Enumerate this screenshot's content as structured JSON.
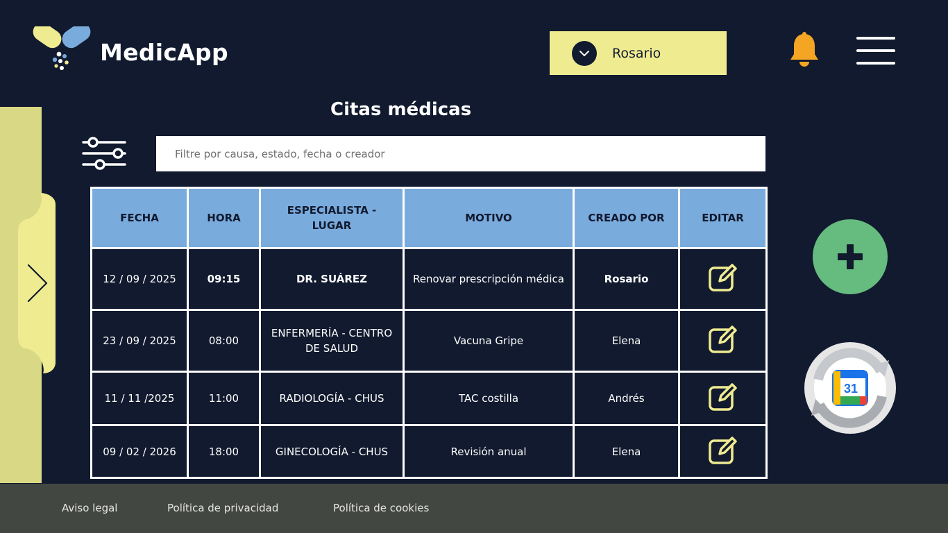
{
  "header": {
    "brand": "MedicApp",
    "user_selector": {
      "selected": "Rosario"
    }
  },
  "page": {
    "title": "Citas médicas"
  },
  "search": {
    "placeholder": "Filtre por causa, estado, fecha o creador"
  },
  "table": {
    "columns": [
      "FECHA",
      "HORA",
      "ESPECIALISTA - LUGAR",
      "MOTIVO",
      "CREADO POR",
      "EDITAR"
    ],
    "rows": [
      {
        "fecha": "12 / 09 / 2025",
        "hora": "09:15",
        "especialista": "DR. SUÁREZ",
        "motivo": "Renovar prescripción médica",
        "creado_por": "Rosario"
      },
      {
        "fecha": "23 / 09 / 2025",
        "hora": "08:00",
        "especialista": "ENFERMERÍA - CENTRO DE SALUD",
        "motivo": "Vacuna Gripe",
        "creado_por": "Elena"
      },
      {
        "fecha": "11 / 11 /2025",
        "hora": "11:00",
        "especialista": "RADIOLOGÍA - CHUS",
        "motivo": "TAC costilla",
        "creado_por": "Andrés"
      },
      {
        "fecha": "09 / 02 / 2026",
        "hora": "18:00",
        "especialista": "GINECOLOGÍA - CHUS",
        "motivo": "Revisión anual",
        "creado_por": "Elena"
      }
    ]
  },
  "calendar_icon": {
    "day": "31"
  },
  "footer": {
    "links": [
      "Aviso legal",
      "Política de privacidad",
      "Política de cookies"
    ]
  },
  "colors": {
    "background": "#111a2e",
    "accent_yellow": "#efeb91",
    "table_header": "#7aabdd",
    "add_button": "#66bb7e",
    "bell": "#f5a524",
    "footer": "#434741"
  },
  "icons": [
    "logo-icon",
    "chevron-down-icon",
    "bell-icon",
    "hamburger-menu-icon",
    "chevron-right-icon",
    "filter-sliders-icon",
    "edit-icon",
    "plus-icon",
    "google-calendar-sync-icon"
  ]
}
